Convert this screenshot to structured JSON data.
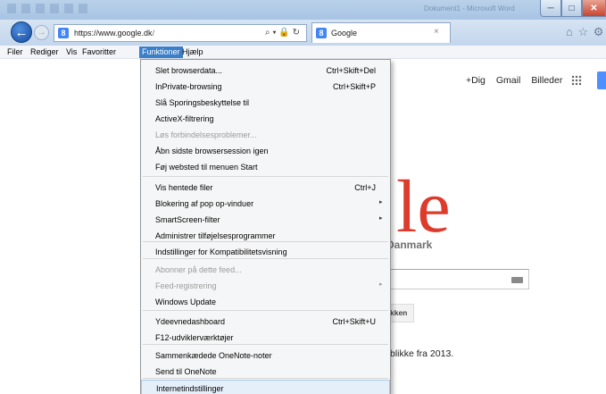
{
  "window": {
    "ghost_title": "Dokument1 - Microsoft Word",
    "minimize_symbol": "─",
    "maximize_symbol": "□",
    "close_symbol": "✕"
  },
  "nav": {
    "back_symbol": "←",
    "forward_symbol": "→",
    "url_host": "https://www.google.dk",
    "url_rest": "/",
    "address_icons": "⌕ ▾ 🔒 ↻",
    "favicon_letter": "8",
    "tab_title": "Google",
    "tab_close": "×",
    "right_icons": "⌂ ☆ ⚙"
  },
  "menubar": {
    "items": [
      "Filer",
      "Rediger",
      "Vis",
      "Favoritter",
      "Funktioner",
      "Hjælp"
    ],
    "active": "Funktioner"
  },
  "page": {
    "links": [
      "+Dig",
      "Gmail",
      "Billeder"
    ],
    "logo_partial": "le",
    "logo_sub": "Danmark",
    "button_partial": "kken",
    "footer_partial": "blikke fra 2013."
  },
  "dropdown": {
    "items": [
      {
        "label": "Slet browserdata...",
        "shortcut": "Ctrl+Skift+Del",
        "submenu": false,
        "disabled": false
      },
      {
        "label": "InPrivate-browsing",
        "shortcut": "Ctrl+Skift+P",
        "submenu": false,
        "disabled": false
      },
      {
        "label": "Slå Sporingsbeskyttelse til",
        "shortcut": "",
        "submenu": false,
        "disabled": false
      },
      {
        "label": "ActiveX-filtrering",
        "shortcut": "",
        "submenu": false,
        "disabled": false
      },
      {
        "label": "Løs forbindelsesproblemer...",
        "shortcut": "",
        "submenu": false,
        "disabled": true
      },
      {
        "label": "Åbn sidste browsersession igen",
        "shortcut": "",
        "submenu": false,
        "disabled": false
      },
      {
        "label": "Føj websted til menuen Start",
        "shortcut": "",
        "submenu": false,
        "disabled": false
      },
      {
        "label": "Vis hentede filer",
        "shortcut": "Ctrl+J",
        "submenu": false,
        "disabled": false
      },
      {
        "label": "Blokering af pop op-vinduer",
        "shortcut": "",
        "submenu": true,
        "disabled": false
      },
      {
        "label": "SmartScreen-filter",
        "shortcut": "",
        "submenu": true,
        "disabled": false
      },
      {
        "label": "Administrer tilføjelsesprogrammer",
        "shortcut": "",
        "submenu": false,
        "disabled": false
      },
      {
        "label": "Indstillinger for Kompatibilitetsvisning",
        "shortcut": "",
        "submenu": false,
        "disabled": false
      },
      {
        "label": "Abonner på dette feed...",
        "shortcut": "",
        "submenu": false,
        "disabled": true
      },
      {
        "label": "Feed-registrering",
        "shortcut": "",
        "submenu": true,
        "disabled": true
      },
      {
        "label": "Windows Update",
        "shortcut": "",
        "submenu": false,
        "disabled": false
      },
      {
        "label": "Ydeevnedashboard",
        "shortcut": "Ctrl+Skift+U",
        "submenu": false,
        "disabled": false
      },
      {
        "label": "F12-udviklerværktøjer",
        "shortcut": "",
        "submenu": false,
        "disabled": false
      },
      {
        "label": "Sammenkædede OneNote-noter",
        "shortcut": "",
        "submenu": false,
        "disabled": false
      },
      {
        "label": "Send til OneNote",
        "shortcut": "",
        "submenu": false,
        "disabled": false
      },
      {
        "label": "Internetindstillinger",
        "shortcut": "",
        "submenu": false,
        "disabled": false,
        "hovered": true
      }
    ],
    "submenu_arrow": "▸"
  }
}
